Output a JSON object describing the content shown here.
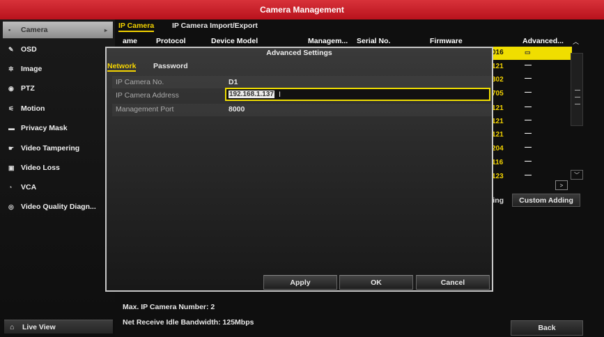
{
  "window": {
    "title": "Camera Management"
  },
  "sidebar": {
    "items": [
      {
        "label": "Camera",
        "icon": "camera-icon",
        "glyph": "▪",
        "active": true
      },
      {
        "label": "OSD",
        "icon": "osd-icon",
        "glyph": "✎"
      },
      {
        "label": "Image",
        "icon": "image-icon",
        "glyph": "✲"
      },
      {
        "label": "PTZ",
        "icon": "ptz-icon",
        "glyph": "◉"
      },
      {
        "label": "Motion",
        "icon": "motion-icon",
        "glyph": "⚟"
      },
      {
        "label": "Privacy Mask",
        "icon": "privacy-mask-icon",
        "glyph": "▬"
      },
      {
        "label": "Video Tampering",
        "icon": "video-tampering-icon",
        "glyph": "☛"
      },
      {
        "label": "Video Loss",
        "icon": "video-loss-icon",
        "glyph": "▣"
      },
      {
        "label": "VCA",
        "icon": "vca-icon",
        "glyph": "◔"
      },
      {
        "label": "Video Quality Diagn...",
        "icon": "video-quality-icon",
        "glyph": "◎"
      }
    ],
    "live_view": {
      "label": "Live View",
      "icon": "home-icon",
      "glyph": "⌂"
    }
  },
  "tabs": [
    {
      "label": "IP Camera",
      "active": true
    },
    {
      "label": "IP Camera Import/Export"
    }
  ],
  "table": {
    "columns": [
      "ame",
      "Protocol",
      "Device Model",
      "Managem...",
      "Serial No.",
      "Firmware",
      "Advanced..."
    ],
    "firmware_partial": [
      "016",
      "121",
      "302",
      "705",
      "121",
      "121",
      "121",
      "204",
      "116",
      "123"
    ],
    "advanced_marks": [
      "▭",
      "—",
      "—",
      "—",
      "—",
      "—",
      "—",
      "—",
      "—",
      "—"
    ]
  },
  "buttons": {
    "adding_partial": "ding",
    "custom_adding": "Custom Adding",
    "back": "Back"
  },
  "footer": {
    "max_ip_camera": "Max. IP Camera Number: 2",
    "bandwidth": "Net Receive Idle Bandwidth: 125Mbps"
  },
  "dialog": {
    "title": "Advanced Settings",
    "tabs": [
      {
        "label": "Network",
        "active": true
      },
      {
        "label": "Password"
      }
    ],
    "fields": {
      "camera_no": {
        "label": "IP Camera No.",
        "value": "D1"
      },
      "address": {
        "label": "IP Camera Address",
        "value": "192.168.1.137"
      },
      "port": {
        "label": "Management Port",
        "value": "8000"
      }
    },
    "buttons": {
      "apply": "Apply",
      "ok": "OK",
      "cancel": "Cancel"
    }
  }
}
